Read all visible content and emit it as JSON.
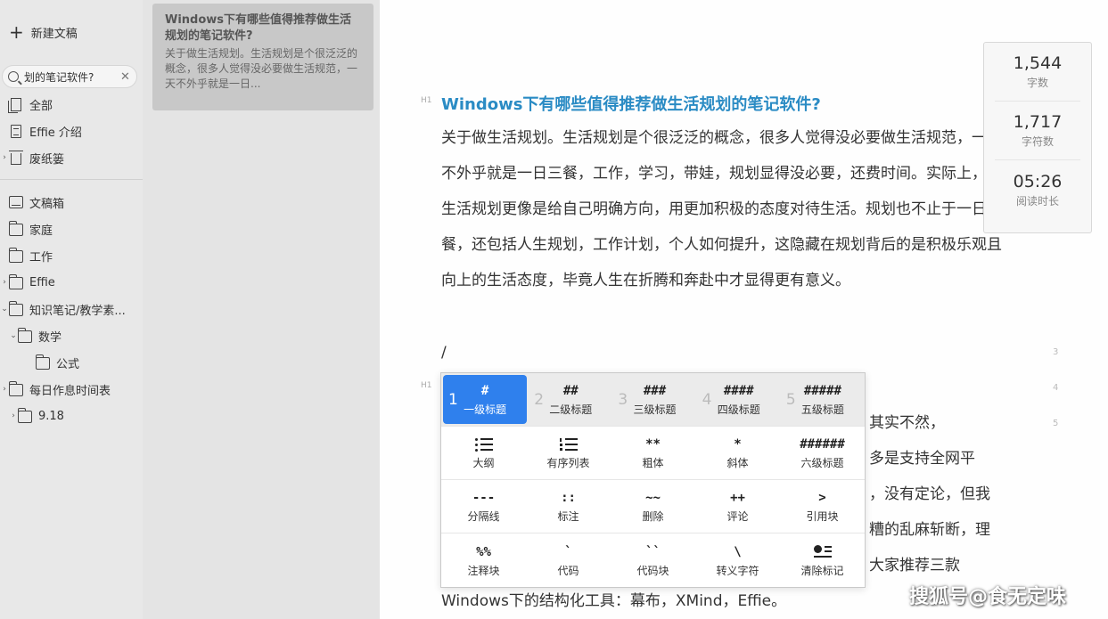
{
  "sidebar": {
    "new_doc_label": "新建文稿",
    "search_value": "划的笔记软件?",
    "items": [
      {
        "label": "全部"
      },
      {
        "label": "Effie 介绍"
      },
      {
        "label": "废纸篓"
      },
      {
        "label": "文稿箱"
      },
      {
        "label": "家庭"
      },
      {
        "label": "工作"
      },
      {
        "label": "Effie"
      },
      {
        "label": "知识笔记/教学素..."
      },
      {
        "label": "数学"
      },
      {
        "label": "公式"
      },
      {
        "label": "每日作息时间表"
      },
      {
        "label": "9.18"
      }
    ]
  },
  "note_list": {
    "card": {
      "title": "Windows下有哪些值得推荐做生活规划的笔记软件?",
      "snippet": "关于做生活规划。生活规划是个很泛泛的概念，很多人觉得没必要做生活规范，一天不外乎就是一日..."
    }
  },
  "editor": {
    "h1_tag": "H1",
    "title": "Windows下有哪些值得推荐做生活规划的笔记软件?",
    "para1": "关于做生活规划。生活规划是个很泛泛的概念，很多人觉得没必要做生活规范，一天不外乎就是一日三餐，工作，学习，带娃，规划显得没必要，还费时间。实际上，做生活规划更像是给自己明确方向，用更加积极的态度对待生活。规划也不止于一日三餐，还包括人生规划，工作计划，个人如何提升，这隐藏在规划背后的是积极乐观且向上的生活态度，毕竟人生在折腾和奔赴中才显得更有意义。",
    "slash": "/",
    "line_nums": [
      "3",
      "4",
      "5"
    ],
    "partial_lines": [
      "其实不然，",
      "多是支持全网平",
      "，没有定论，但我",
      "糟的乱麻斩断，理",
      "大家推荐三款"
    ],
    "last_line": "Windows下的结构化工具：幕布，XMind，Effie。"
  },
  "stats": [
    {
      "value": "1,544",
      "label": "字数"
    },
    {
      "value": "1,717",
      "label": "字符数"
    },
    {
      "value": "05:26",
      "label": "阅读时长"
    }
  ],
  "slash_menu": {
    "row1": [
      {
        "num": "1",
        "sym": "#",
        "label": "一级标题"
      },
      {
        "num": "2",
        "sym": "##",
        "label": "二级标题"
      },
      {
        "num": "3",
        "sym": "###",
        "label": "三级标题"
      },
      {
        "num": "4",
        "sym": "####",
        "label": "四级标题"
      },
      {
        "num": "5",
        "sym": "#####",
        "label": "五级标题"
      }
    ],
    "row2": [
      {
        "sym": "",
        "label": "大纲"
      },
      {
        "sym": "",
        "label": "有序列表"
      },
      {
        "sym": "**",
        "label": "粗体"
      },
      {
        "sym": "*",
        "label": "斜体"
      },
      {
        "sym": "######",
        "label": "六级标题"
      }
    ],
    "row3": [
      {
        "sym": "---",
        "label": "分隔线"
      },
      {
        "sym": "::",
        "label": "标注"
      },
      {
        "sym": "~~",
        "label": "删除"
      },
      {
        "sym": "++",
        "label": "评论"
      },
      {
        "sym": ">",
        "label": "引用块"
      }
    ],
    "row4": [
      {
        "sym": "%%",
        "label": "注释块"
      },
      {
        "sym": "`",
        "label": "代码"
      },
      {
        "sym": "``",
        "label": "代码块"
      },
      {
        "sym": "\\",
        "label": "转义字符"
      },
      {
        "sym": "",
        "label": "清除标记"
      }
    ]
  },
  "watermark": "搜狐号@食无定味"
}
